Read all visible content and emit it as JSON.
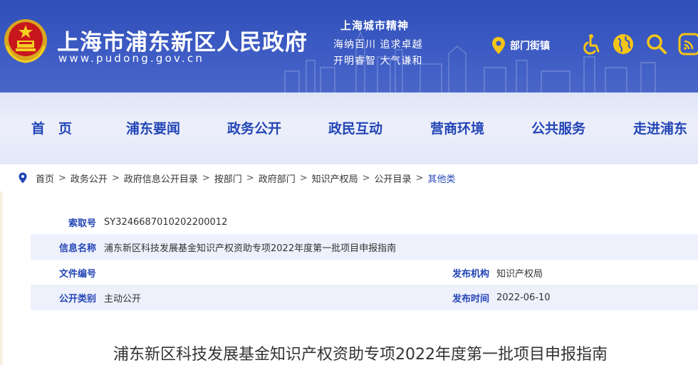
{
  "header": {
    "site_title": "上海市浦东新区人民政府",
    "site_url": "www.pudong.gov.cn",
    "spirit_title": "上海城市精神",
    "spirit_line1": "海纳百川  追求卓越",
    "spirit_line2": "开明睿智  大气谦和",
    "towns_label": "部门街镇",
    "icons": [
      "accessibility-icon",
      "globe-icon",
      "search-icon",
      "rss-icon"
    ]
  },
  "nav": {
    "items": [
      "首　页",
      "浦东要闻",
      "政务公开",
      "政民互动",
      "营商环境",
      "公共服务",
      "走进浦东"
    ]
  },
  "breadcrumb": {
    "items": [
      "首页",
      "政务公开",
      "政府信息公开目录",
      "按部门",
      "政府部门",
      "知识产权局",
      "公开目录"
    ],
    "current": "其他类",
    "separator": ">"
  },
  "info": {
    "index_label": "索取号",
    "index_value": "SY3246687010202200012",
    "name_label": "信息名称",
    "name_value": "浦东新区科技发展基金知识产权资助专项2022年度第一批项目申报指南",
    "docno_label": "文件编号",
    "docno_value": "",
    "publisher_label": "发布机构",
    "publisher_value": "知识产权局",
    "category_label": "公开类别",
    "category_value": "主动公开",
    "date_label": "发布时间",
    "date_value": "2022-06-10"
  },
  "article": {
    "title": "浦东新区科技发展基金知识产权资助专项2022年度第一批项目申报指南"
  },
  "colors": {
    "header_blue": "#3a56c0",
    "nav_text": "#2345b6",
    "label_blue": "#2345b6",
    "row_shade": "#eef0fb",
    "accent_yellow": "#f5c518"
  }
}
